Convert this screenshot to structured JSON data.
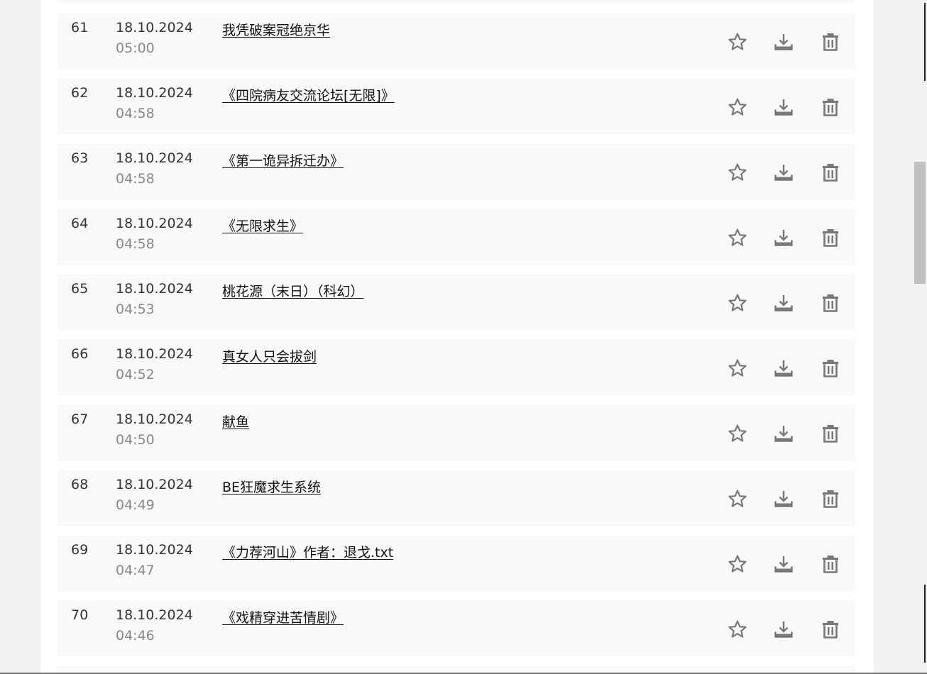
{
  "rows": [
    {
      "num": "61",
      "date": "18.10.2024",
      "time": "05:00",
      "title": "我凭破案冠绝京华"
    },
    {
      "num": "62",
      "date": "18.10.2024",
      "time": "04:58",
      "title": "《四院病友交流论坛[无限]》"
    },
    {
      "num": "63",
      "date": "18.10.2024",
      "time": "04:58",
      "title": "《第一诡异拆迁办》"
    },
    {
      "num": "64",
      "date": "18.10.2024",
      "time": "04:58",
      "title": "《无限求生》"
    },
    {
      "num": "65",
      "date": "18.10.2024",
      "time": "04:53",
      "title": "桃花源（末日）（科幻）"
    },
    {
      "num": "66",
      "date": "18.10.2024",
      "time": "04:52",
      "title": "真女人只会拔剑"
    },
    {
      "num": "67",
      "date": "18.10.2024",
      "time": "04:50",
      "title": "献鱼"
    },
    {
      "num": "68",
      "date": "18.10.2024",
      "time": "04:49",
      "title": "BE狂魔求生系统"
    },
    {
      "num": "69",
      "date": "18.10.2024",
      "time": "04:47",
      "title": "《力荐河山》作者：退戈.txt"
    },
    {
      "num": "70",
      "date": "18.10.2024",
      "time": "04:46",
      "title": "《戏精穿进苦情剧》"
    }
  ],
  "icons": {
    "favorite": "star-outline-icon",
    "download": "download-icon",
    "delete": "trash-icon"
  },
  "colors": {
    "row_background": "#f9f9f9",
    "icon_color": "#777777",
    "time_color": "#888888"
  }
}
